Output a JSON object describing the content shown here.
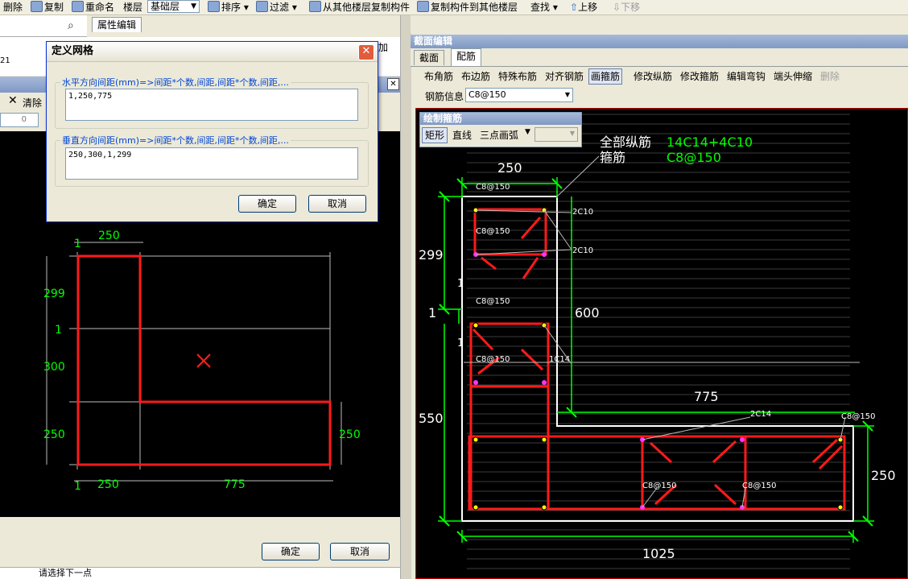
{
  "toolbar": {
    "items": [
      {
        "label": "删除",
        "icon": "delete-icon"
      },
      {
        "label": "复制",
        "icon": "copy-icon"
      },
      {
        "label": "重命名",
        "icon": "rename-icon"
      },
      {
        "label": "楼层",
        "icon": ""
      },
      {
        "label": "排序",
        "icon": "sort-icon"
      },
      {
        "label": "过滤",
        "icon": "filter-icon"
      },
      {
        "label": "从其他楼层复制构件",
        "icon": "copy-from-floor-icon"
      },
      {
        "label": "复制构件到其他楼层",
        "icon": "copy-to-floor-icon"
      },
      {
        "label": "查找",
        "icon": ""
      },
      {
        "label": "上移",
        "icon": "arrow-up-icon"
      },
      {
        "label": "下移",
        "icon": "arrow-down-icon"
      }
    ],
    "floor_select": "基础层"
  },
  "left_panel": {
    "tab_properties": "属性编辑",
    "add_label": "加",
    "number_fragment": "21",
    "clear_label": "清除",
    "spin_value": "0",
    "confirm": "确定",
    "cancel": "取消",
    "status": "请选择下一点"
  },
  "dialog": {
    "title": "定义网格",
    "horizontal_legend": "水平方向间距(mm)=>间距*个数,间距,间距*个数,间距,...",
    "horizontal_value": "1,250,775",
    "vertical_legend": "垂直方向间距(mm)=>间距*个数,间距,间距*个数,间距,...",
    "vertical_value": "250,300,1,299",
    "confirm": "确定",
    "cancel": "取消"
  },
  "left_canvas": {
    "labels": {
      "top_one": "1",
      "top_250": "250",
      "left_299": "299",
      "left_1": "1",
      "left_300": "300",
      "left_250": "250",
      "right_250": "250",
      "bottom_one": "1",
      "bottom_250": "250",
      "bottom_775": "775"
    }
  },
  "section_editor": {
    "title": "截面编辑",
    "tabs": [
      "截面",
      "配筋"
    ],
    "tools": [
      "布角筋",
      "布边筋",
      "特殊布筋",
      "对齐钢筋",
      "画箍筋",
      "修改纵筋",
      "修改箍筋",
      "编辑弯钩",
      "端头伸缩",
      "删除"
    ],
    "rebar_info_label": "钢筋信息",
    "rebar_info_value": "C8@150",
    "draw_panel_title": "绘制箍筋",
    "draw_modes": [
      "矩形",
      "直线",
      "三点画弧"
    ],
    "summary_label_1": "全部纵筋",
    "summary_value_1": "14C14+4C10",
    "summary_label_2": "箍筋",
    "summary_value_2": "C8@150",
    "dims": {
      "top_250": "250",
      "left_299": "299",
      "left_1": "1",
      "mid_600": "600",
      "left_550": "550",
      "mid_775": "775",
      "right_250": "250",
      "bottom_1025": "1025",
      "small_1a": "1",
      "small_1b": "1"
    },
    "annotations": {
      "s1": "C8@150",
      "s2": "C8@150",
      "s3": "C8@150",
      "s4": "C8@150",
      "s5": "C8@150",
      "s6": "C8@150",
      "s7": "C8@150",
      "bar1": "2C10",
      "bar2": "2C10",
      "bar3": "1C14",
      "bar4": "2C14"
    }
  },
  "colors": {
    "rebar": "#ff1a1a",
    "dimension": "#00ff00",
    "outline": "#ffffff",
    "canvas": "#000000",
    "title_blue": "#0046d5"
  }
}
